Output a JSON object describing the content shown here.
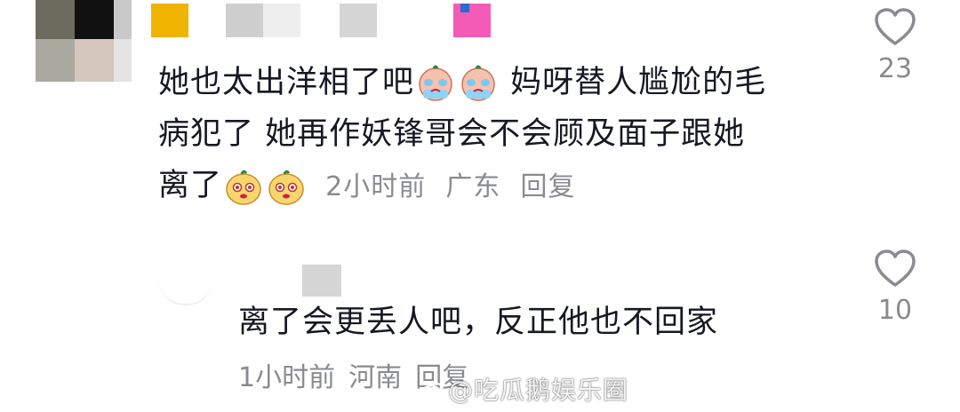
{
  "comments": [
    {
      "text_line1": "她也太出洋相了吧",
      "text_line1b": "妈呀替人尴尬的毛",
      "text_line2": "病犯了 她再作妖锋哥会不会顾及面子跟她",
      "text_line3": "离了",
      "time": "2小时前",
      "location": "广东",
      "reply_label": "回复",
      "likes": "23",
      "emoji_1": "crying-face-emoji",
      "emoji_2": "smirk-face-emoji"
    },
    {
      "text": "离了会更丢人吧，反正他也不回家",
      "time": "1小时前",
      "location": "河南",
      "reply_label": "回复",
      "likes": "10"
    }
  ],
  "watermark": "@吃瓜鹅娱乐圈",
  "colors": {
    "text": "#161823",
    "meta": "#8a8b91",
    "mosaic_gray": "#d9d9d9",
    "mosaic_yellow": "#f0b400",
    "mosaic_pink": "#f45bb6"
  }
}
